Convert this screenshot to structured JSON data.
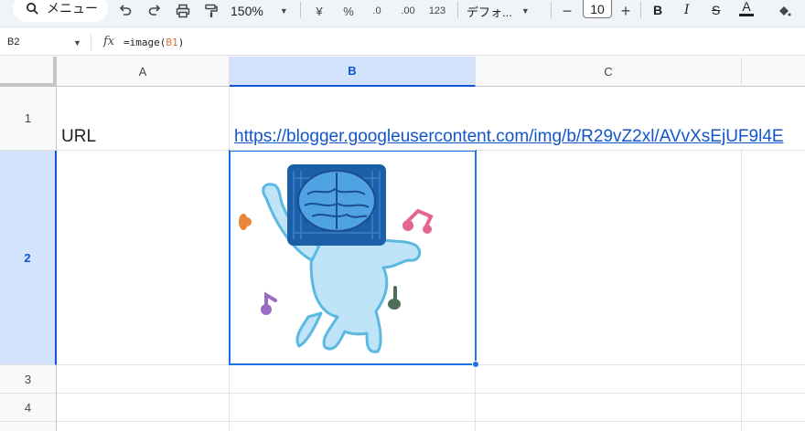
{
  "toolbar": {
    "search_label": "メニュー",
    "zoom": "150%",
    "currency": "¥",
    "percent": "%",
    "dec_decrease": ".0",
    "dec_increase": ".00",
    "number_format": "123",
    "font": "デフォ...",
    "minus": "−",
    "font_size": "10",
    "plus": "+",
    "bold": "B",
    "italic": "I",
    "strike": "S",
    "text_color": "A",
    "accent_color": "#0b57d0"
  },
  "formula_bar": {
    "cell_ref": "B2",
    "fx": "fx",
    "formula_prefix": "=image(",
    "formula_ref": "B1",
    "formula_suffix": ")"
  },
  "grid": {
    "columns": [
      "A",
      "B",
      "C"
    ],
    "rows": [
      "1",
      "2",
      "3",
      "4"
    ],
    "a1": "URL",
    "b1": "https://blogger.googleusercontent.com/img/b/R29vZ2xl/AVvXsEjUF9l4E",
    "selected_cell": "B2"
  },
  "image": {
    "description_icon": "brain-robot-dancing-illustration",
    "colors": {
      "head": "#1b5fa8",
      "brain": "#4fa3e3",
      "body": "#bfe4f7",
      "outline": "#5bb8e0",
      "note_orange": "#e8873a",
      "note_pink": "#e2668f",
      "note_purple": "#9a6cc2",
      "note_green": "#4f6e55"
    }
  }
}
